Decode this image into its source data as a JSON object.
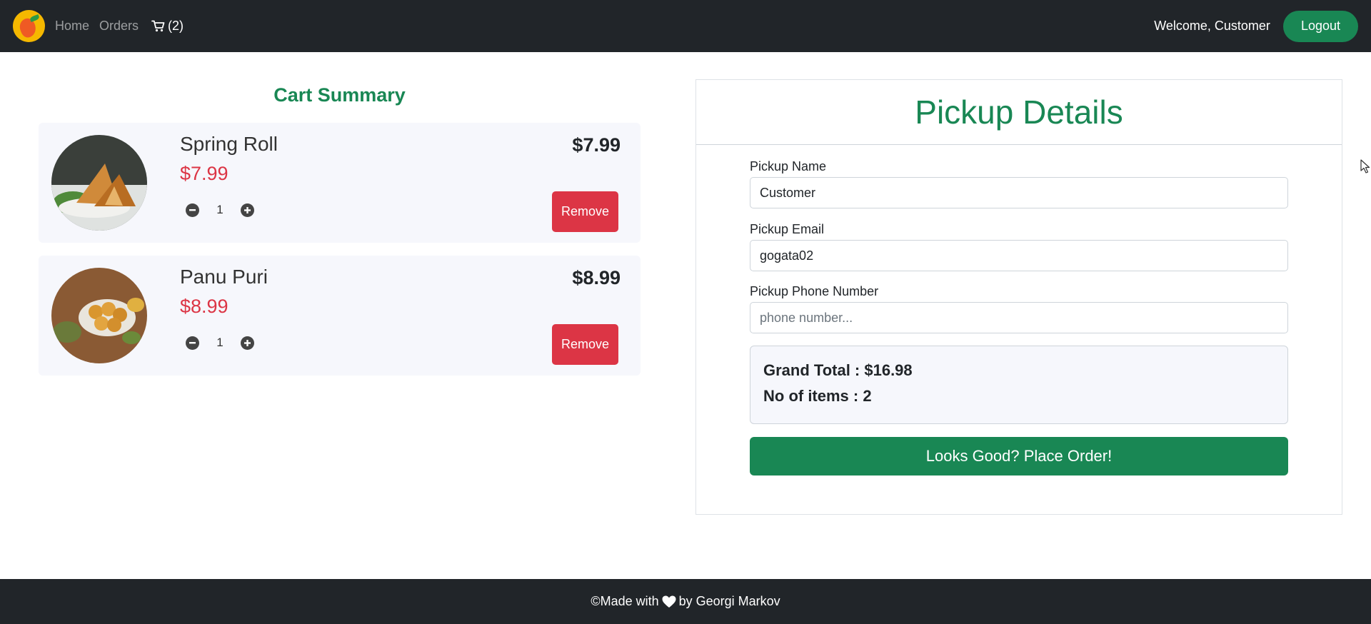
{
  "nav": {
    "home": "Home",
    "orders": "Orders",
    "cart_count": "(2)",
    "welcome": "Welcome, Customer",
    "logout": "Logout"
  },
  "cart": {
    "title": "Cart Summary",
    "items": [
      {
        "name": "Spring Roll",
        "price": "$7.99",
        "total": "$7.99",
        "qty": "1",
        "remove": "Remove"
      },
      {
        "name": "Panu Puri",
        "price": "$8.99",
        "total": "$8.99",
        "qty": "1",
        "remove": "Remove"
      }
    ]
  },
  "pickup": {
    "title": "Pickup Details",
    "name_label": "Pickup Name",
    "name_value": "Customer",
    "email_label": "Pickup Email",
    "email_value": "gogata02",
    "phone_label": "Pickup Phone Number",
    "phone_placeholder": "phone number...",
    "grand_total": "Grand Total : $16.98",
    "item_count": "No of items : 2",
    "order_button": "Looks Good? Place Order!"
  },
  "footer": {
    "prefix": "©Made with",
    "suffix": "by Georgi Markov"
  },
  "colors": {
    "navbar": "#212529",
    "accent": "#198754",
    "danger": "#dc3545",
    "card_bg": "#f6f7fc"
  }
}
